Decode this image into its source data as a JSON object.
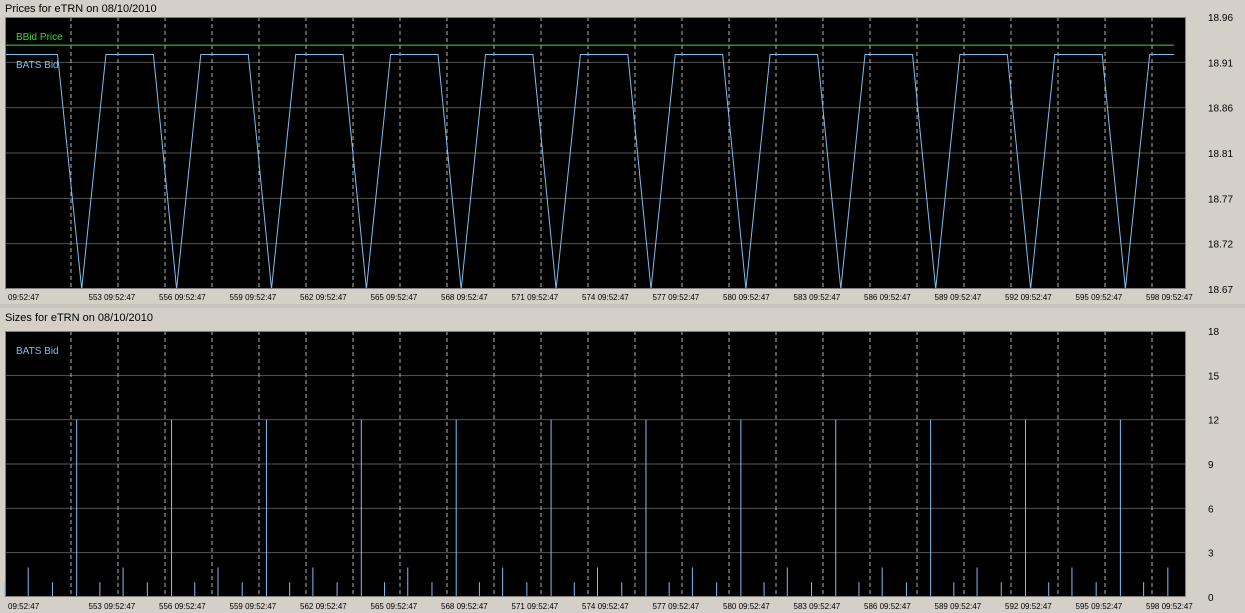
{
  "colors": {
    "background": "#000000",
    "grid_solid": "#555555",
    "grid_dashed": "#b0b0b0",
    "bbid": "#33dd33",
    "bats": "#7fbff0",
    "panel": "#d4d0c8"
  },
  "chart_data": [
    {
      "type": "line",
      "title": "Prices for  eTRN  on  08/10/2010",
      "xlabel": "",
      "ylabel": "",
      "ylim": [
        18.67,
        18.96
      ],
      "yticks": [
        "18.67",
        "18.72",
        "18.77",
        "18.81",
        "18.86",
        "18.91",
        "18.96"
      ],
      "xticks": [
        "09:52:47",
        "553 09:52:47",
        "556 09:52:47",
        "559 09:52:47",
        "562 09:52:47",
        "565 09:52:47",
        "568 09:52:47",
        "571 09:52:47",
        "574 09:52:47",
        "577 09:52:47",
        "580 09:52:47",
        "583 09:52:47",
        "586 09:52:47",
        "589 09:52:47",
        "592 09:52:47",
        "595 09:52:47",
        "598 09:52:47"
      ],
      "xlim": [
        0,
        1170
      ],
      "grid": true,
      "series": [
        {
          "name": "BBid Price",
          "color": "#33dd33",
          "x": [
            0,
            1158
          ],
          "y": [
            18.93,
            18.93
          ]
        },
        {
          "name": "BATS Bid",
          "color": "#7fbff0",
          "x": [
            0,
            52,
            76,
            100,
            147,
            170,
            194,
            241,
            264,
            288,
            335,
            358,
            382,
            429,
            452,
            476,
            523,
            546,
            570,
            617,
            640,
            664,
            711,
            734,
            758,
            805,
            828,
            852,
            899,
            922,
            946,
            993,
            1016,
            1040,
            1087,
            1110,
            1134,
            1158
          ],
          "y": [
            18.92,
            18.92,
            18.67,
            18.92,
            18.92,
            18.67,
            18.92,
            18.92,
            18.67,
            18.92,
            18.92,
            18.67,
            18.92,
            18.92,
            18.67,
            18.92,
            18.92,
            18.67,
            18.92,
            18.92,
            18.67,
            18.92,
            18.92,
            18.67,
            18.92,
            18.92,
            18.67,
            18.92,
            18.92,
            18.67,
            18.92,
            18.92,
            18.67,
            18.92,
            18.92,
            18.67,
            18.92,
            18.92
          ]
        }
      ]
    },
    {
      "type": "bar",
      "title": "Sizes for  eTRN  on  08/10/2010",
      "xlabel": "",
      "ylabel": "",
      "ylim": [
        0,
        18
      ],
      "yticks": [
        "0",
        "3",
        "6",
        "9",
        "12",
        "15",
        "18"
      ],
      "xticks": [
        "09:52:47",
        "553 09:52:47",
        "556 09:52:47",
        "559 09:52:47",
        "562 09:52:47",
        "565 09:52:47",
        "568 09:52:47",
        "571 09:52:47",
        "574 09:52:47",
        "577 09:52:47",
        "580 09:52:47",
        "583 09:52:47",
        "586 09:52:47",
        "589 09:52:47",
        "592 09:52:47",
        "595 09:52:47",
        "598 09:52:47"
      ],
      "xlim": [
        0,
        1170
      ],
      "grid": true,
      "series": [
        {
          "name": "BATS Bid",
          "color": "#7fbff0",
          "x": [
            0,
            23,
            47,
            71,
            94,
            117,
            141,
            165,
            188,
            211,
            235,
            259,
            282,
            305,
            329,
            353,
            376,
            399,
            423,
            447,
            470,
            493,
            517,
            541,
            564,
            587,
            611,
            635,
            658,
            681,
            705,
            729,
            752,
            775,
            799,
            823,
            846,
            869,
            893,
            917,
            940,
            963,
            987,
            1011,
            1034,
            1057,
            1081,
            1105,
            1128,
            1152
          ],
          "values": [
            1,
            2,
            1,
            12,
            1,
            2,
            1,
            12,
            1,
            2,
            1,
            12,
            1,
            2,
            1,
            12,
            1,
            2,
            1,
            12,
            1,
            2,
            1,
            12,
            1,
            2,
            1,
            12,
            1,
            2,
            1,
            12,
            1,
            2,
            1,
            12,
            1,
            2,
            1,
            12,
            1,
            2,
            1,
            12,
            1,
            2,
            1,
            12,
            1,
            2
          ]
        }
      ]
    }
  ]
}
